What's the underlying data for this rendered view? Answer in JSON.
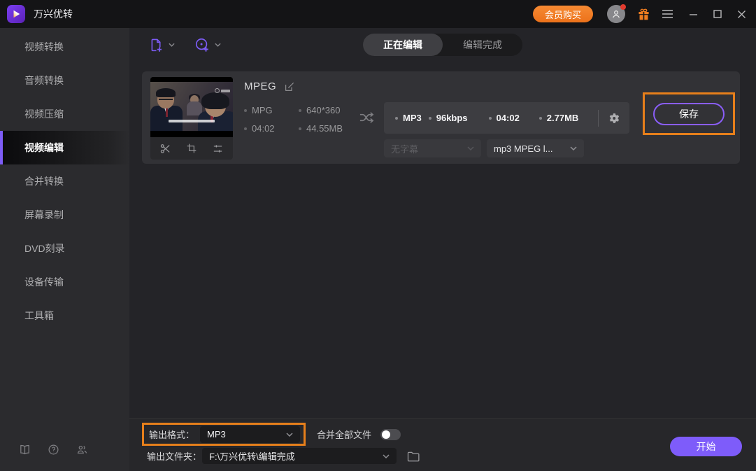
{
  "titlebar": {
    "app_title": "万兴优转",
    "buy_button": "会员购买"
  },
  "sidebar": {
    "items": [
      {
        "label": "视频转换",
        "active": false
      },
      {
        "label": "音频转换",
        "active": false
      },
      {
        "label": "视频压缩",
        "active": false
      },
      {
        "label": "视频编辑",
        "active": true
      },
      {
        "label": "合并转换",
        "active": false
      },
      {
        "label": "屏幕录制",
        "active": false
      },
      {
        "label": "DVD刻录",
        "active": false
      },
      {
        "label": "设备传输",
        "active": false
      },
      {
        "label": "工具箱",
        "active": false
      }
    ]
  },
  "toolbar": {
    "tabs": [
      {
        "label": "正在编辑",
        "active": true
      },
      {
        "label": "编辑完成",
        "active": false
      }
    ]
  },
  "file_card": {
    "title": "MPEG",
    "source": {
      "format": "MPG",
      "resolution": "640*360",
      "duration": "04:02",
      "size": "44.55MB"
    },
    "output": {
      "format": "MP3",
      "bitrate": "96kbps",
      "duration": "04:02",
      "size": "2.77MB"
    },
    "subtitle_dropdown_value": "无字幕",
    "audio_format_dropdown_value": "mp3 MPEG l...",
    "save_button": "保存"
  },
  "footer": {
    "output_format_label": "输出格式：",
    "output_format_value": "MP3",
    "merge_all_label": "合并全部文件",
    "merge_all_on": false,
    "output_folder_label": "输出文件夹：",
    "output_folder_value": "F:\\万兴优转\\编辑完成",
    "start_button": "开始"
  },
  "colors": {
    "accent_purple": "#7d5cf6",
    "highlight_orange": "#e67f1b",
    "brand_orange": "#ee7c20",
    "start_button_purple": "#7e5cfa"
  }
}
